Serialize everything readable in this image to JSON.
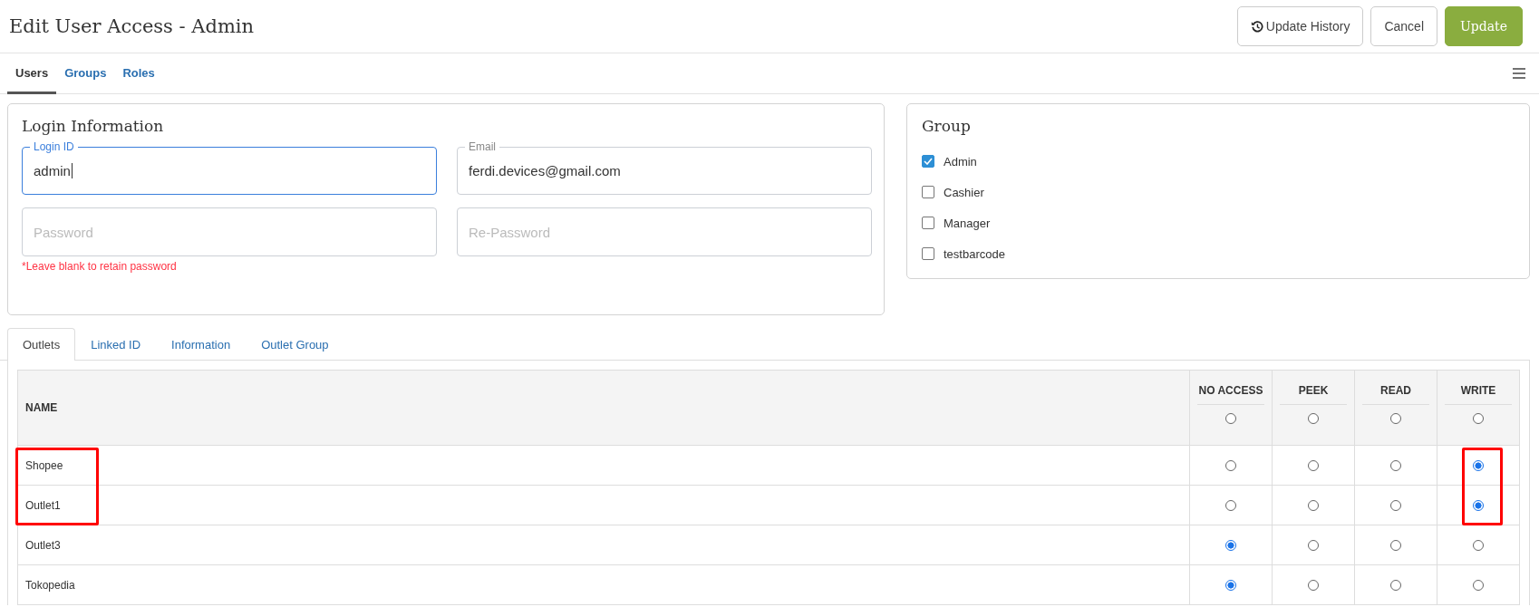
{
  "header": {
    "title": "Edit User Access - Admin",
    "buttons": [
      {
        "kind": "history",
        "label": "Update History"
      },
      {
        "kind": "plain",
        "label": "Cancel"
      },
      {
        "kind": "primary",
        "label": "Update"
      }
    ]
  },
  "tabs": [
    {
      "label": "Users",
      "selected": true
    },
    {
      "label": "Groups",
      "selected": false
    },
    {
      "label": "Roles",
      "selected": false
    }
  ],
  "login": {
    "title": "Login Information",
    "fields": [
      {
        "label": "Login ID",
        "value": "admin",
        "focused": true
      },
      {
        "label": "Email",
        "value": "ferdi.devices@gmail.com",
        "focused": false
      },
      {
        "placeholder": "Password",
        "focused": false
      },
      {
        "placeholder": "Re-Password",
        "focused": false
      }
    ],
    "hint": "*Leave blank to retain password"
  },
  "group": {
    "title": "Group",
    "items": [
      {
        "label": "Admin",
        "checked": true
      },
      {
        "label": "Cashier",
        "checked": false
      },
      {
        "label": "Manager",
        "checked": false
      },
      {
        "label": "testbarcode",
        "checked": false
      }
    ]
  },
  "sub_tabs": [
    {
      "label": "Outlets",
      "selected": true
    },
    {
      "label": "Linked ID",
      "selected": false
    },
    {
      "label": "Information",
      "selected": false
    },
    {
      "label": "Outlet Group",
      "selected": false
    }
  ],
  "table": {
    "columns": [
      "NAME",
      "NO ACCESS",
      "PEEK",
      "READ",
      "WRITE"
    ],
    "header_radios": [
      {
        "selected": false
      },
      {
        "selected": false
      },
      {
        "selected": false
      },
      {
        "selected": false
      }
    ],
    "rows": [
      {
        "name": "Shopee",
        "name_marked": true,
        "radios": [
          {
            "selected": false
          },
          {
            "selected": false
          },
          {
            "selected": false
          },
          {
            "selected": true,
            "marked": true
          }
        ]
      },
      {
        "name": "Outlet1",
        "name_marked": true,
        "radios": [
          {
            "selected": false
          },
          {
            "selected": false
          },
          {
            "selected": false
          },
          {
            "selected": true,
            "marked": true
          }
        ]
      },
      {
        "name": "Outlet3",
        "radios": [
          {
            "selected": true
          },
          {
            "selected": false
          },
          {
            "selected": false
          },
          {
            "selected": false
          }
        ]
      },
      {
        "name": "Tokopedia",
        "radios": [
          {
            "selected": true
          },
          {
            "selected": false
          },
          {
            "selected": false
          },
          {
            "selected": false
          }
        ]
      }
    ]
  }
}
